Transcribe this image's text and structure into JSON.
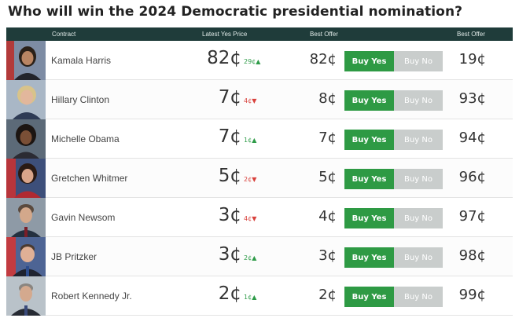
{
  "title": "Who will win the 2024 Democratic presidential nomination?",
  "columns": {
    "contract": "Contract",
    "latest_yes_price": "Latest Yes Price",
    "best_offer_yes": "Best Offer",
    "best_offer_no": "Best Offer"
  },
  "buttons": {
    "yes": "Buy Yes",
    "no": "Buy No"
  },
  "colors": {
    "header_bg": "#1f3c3a",
    "buy_yes": "#2e9a44",
    "buy_no": "#c9cdcc",
    "up": "#2e9b48",
    "down": "#d8413c"
  },
  "rows": [
    {
      "name": "Kamala Harris",
      "price": "82¢",
      "change": "29¢",
      "direction": "up",
      "best_yes": "82¢",
      "best_no": "19¢",
      "avatar": "portrait-photo"
    },
    {
      "name": "Hillary Clinton",
      "price": "7¢",
      "change": "4¢",
      "direction": "down",
      "best_yes": "8¢",
      "best_no": "93¢",
      "avatar": "portrait-photo"
    },
    {
      "name": "Michelle Obama",
      "price": "7¢",
      "change": "1¢",
      "direction": "up",
      "best_yes": "7¢",
      "best_no": "94¢",
      "avatar": "portrait-photo"
    },
    {
      "name": "Gretchen Whitmer",
      "price": "5¢",
      "change": "2¢",
      "direction": "down",
      "best_yes": "5¢",
      "best_no": "96¢",
      "avatar": "portrait-photo"
    },
    {
      "name": "Gavin Newsom",
      "price": "3¢",
      "change": "4¢",
      "direction": "down",
      "best_yes": "4¢",
      "best_no": "97¢",
      "avatar": "portrait-photo"
    },
    {
      "name": "JB Pritzker",
      "price": "3¢",
      "change": "2¢",
      "direction": "up",
      "best_yes": "3¢",
      "best_no": "98¢",
      "avatar": "portrait-photo"
    },
    {
      "name": "Robert Kennedy Jr.",
      "price": "2¢",
      "change": "1¢",
      "direction": "up",
      "best_yes": "2¢",
      "best_no": "99¢",
      "avatar": "portrait-photo"
    }
  ]
}
